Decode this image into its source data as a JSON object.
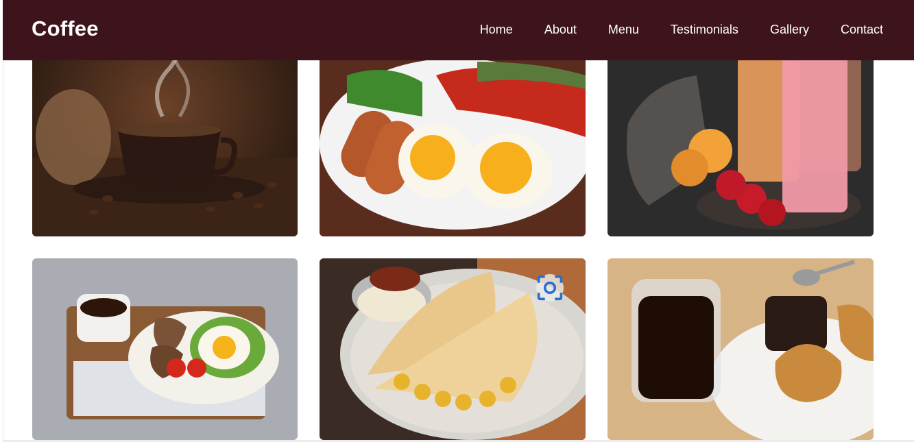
{
  "header": {
    "brand": "Coffee",
    "nav": [
      "Home",
      "About",
      "Menu",
      "Testimonials",
      "Gallery",
      "Contact"
    ],
    "background": "#3d141c"
  },
  "gallery": {
    "tiles": [
      {
        "subject": "coffee cup with steam and beans"
      },
      {
        "subject": "fried eggs, sausages and salad breakfast plate"
      },
      {
        "subject": "smoothies with peaches and strawberries"
      },
      {
        "subject": "tray with coffee, toast hearts and egg"
      },
      {
        "subject": "masala dosa with chutney"
      },
      {
        "subject": "glass of coffee and croissant with honey"
      }
    ],
    "overlay_icon": "visual-search-icon"
  }
}
